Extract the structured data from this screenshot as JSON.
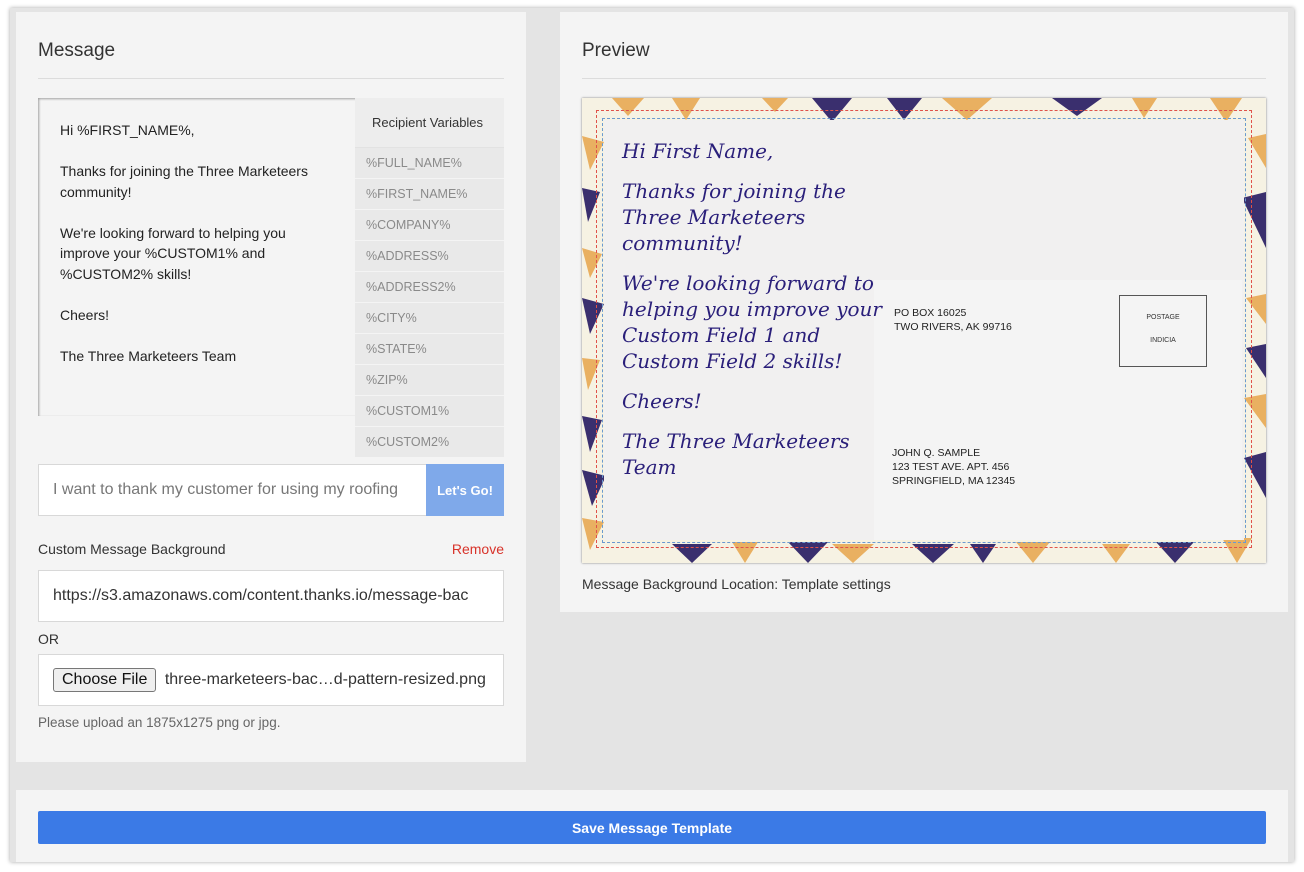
{
  "message_panel": {
    "title": "Message",
    "body_lines": [
      "Hi %FIRST_NAME%,",
      "Thanks for joining the Three Marketeers community!",
      "We're looking forward to helping you improve your %CUSTOM1% and %CUSTOM2% skills!",
      "Cheers!",
      "The Three Marketeers Team"
    ],
    "variables_header": "Recipient Variables",
    "variables": [
      "%FULL_NAME%",
      "%FIRST_NAME%",
      "%COMPANY%",
      "%ADDRESS%",
      "%ADDRESS2%",
      "%CITY%",
      "%STATE%",
      "%ZIP%",
      "%CUSTOM1%",
      "%CUSTOM2%"
    ],
    "prompt_value": "I want to thank my customer for using my roofing",
    "go_label": "Let's Go!",
    "custom_bg_label": "Custom Message Background",
    "remove_label": "Remove",
    "bg_url": "https://s3.amazonaws.com/content.thanks.io/message-bac",
    "or_label": "OR",
    "choose_file_label": "Choose File",
    "file_name": "three-marketeers-bac…d-pattern-resized.png",
    "upload_hint": "Please upload an 1875x1275 png or jpg."
  },
  "preview_panel": {
    "title": "Preview",
    "handwriting": [
      "Hi First Name,",
      "Thanks for joining the Three Marketeers community!",
      "We're looking forward to helping you improve your Custom Field 1 and Custom Field 2 skills!",
      "Cheers!",
      "The Three Marketeers Team"
    ],
    "return_address": [
      "PO BOX 16025",
      "TWO RIVERS, AK 99716"
    ],
    "postage": [
      "POSTAGE",
      "INDICIA"
    ],
    "recipient_address": [
      "JOHN Q. SAMPLE",
      "123 TEST AVE. APT. 456",
      "SPRINGFIELD, MA 12345"
    ],
    "bg_location": "Message Background Location: Template settings"
  },
  "footer": {
    "save_label": "Save Message Template"
  },
  "colors": {
    "primary": "#3b7ae6",
    "go_button": "#7fa9ea",
    "danger": "#d8332a",
    "handwriting": "#2a1f7a"
  }
}
